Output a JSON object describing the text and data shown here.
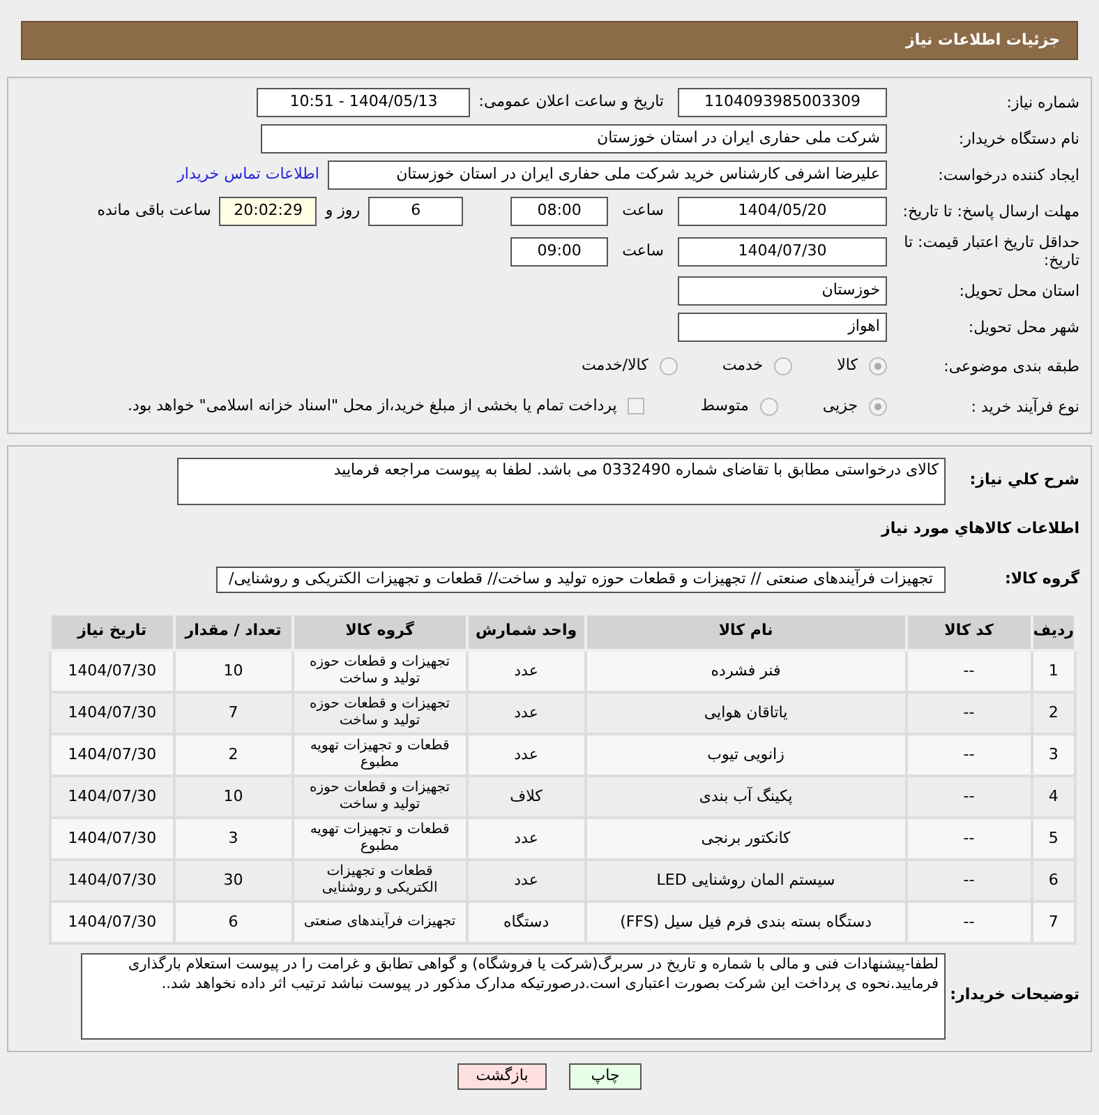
{
  "header": {
    "title": "جزئیات اطلاعات نیاز"
  },
  "need_number": {
    "label": "شماره نیاز:",
    "value": "1104093985003309"
  },
  "announce": {
    "label": "تاریخ و ساعت اعلان عمومی:",
    "value": "1404/05/13 - 10:51"
  },
  "buyer_org": {
    "label": "نام دستگاه خریدار:",
    "value": "شرکت ملی حفاری ایران در استان خوزستان"
  },
  "creator": {
    "label": "ایجاد کننده درخواست:",
    "value": "علیرضا اشرفی کارشناس خرید شرکت ملی حفاری ایران در استان خوزستان",
    "link": "اطلاعات تماس خریدار"
  },
  "deadline": {
    "label": "مهلت ارسال پاسخ: تا تاریخ:",
    "date": "1404/05/20",
    "time_label": "ساعت",
    "time": "08:00",
    "days": "6",
    "days_label": "روز و",
    "remaining": "20:02:29",
    "remaining_label": "ساعت باقی مانده"
  },
  "validity": {
    "label": "حداقل تاریخ اعتبار قیمت: تا تاریخ:",
    "date": "1404/07/30",
    "time_label": "ساعت",
    "time": "09:00"
  },
  "province": {
    "label": "استان محل تحویل:",
    "value": "خوزستان"
  },
  "city": {
    "label": "شهر محل تحویل:",
    "value": "اهواز"
  },
  "category": {
    "label": "طبقه بندی موضوعی:",
    "options": [
      {
        "label": "کالا",
        "selected": true
      },
      {
        "label": "خدمت",
        "selected": false
      },
      {
        "label": "کالا/خدمت",
        "selected": false
      }
    ]
  },
  "process": {
    "label": "نوع فرآیند خرید :",
    "options": [
      {
        "label": "جزیی",
        "selected": true
      },
      {
        "label": "متوسط",
        "selected": false
      }
    ],
    "payment": {
      "label": "پرداخت تمام یا بخشی از مبلغ خرید،از محل \"اسناد خزانه اسلامی\" خواهد بود.",
      "checked": false
    }
  },
  "description": {
    "label": "شرح کلي نياز:",
    "value": "کالای درخواستی مطابق با تقاضای شماره 0332490 می باشد. لطفا به پیوست مراجعه فرمایید"
  },
  "goods_title": "اطلاعات کالاهاي مورد نياز",
  "group": {
    "label": "گروه کالا:",
    "value": "تجهیزات فرآیندهای صنعتی // تجهیزات و قطعات حوزه تولید و ساخت// قطعات و تجهیزات الکتریکی و روشنایی/"
  },
  "table": {
    "columns": [
      "ردیف",
      "کد کالا",
      "نام کالا",
      "واحد شمارش",
      "گروه کالا",
      "تعداد / مقدار",
      "تاریخ نیاز"
    ],
    "rows": [
      [
        "1",
        "--",
        "فنر فشرده",
        "عدد",
        "تجهیزات و قطعات حوزه تولید و ساخت",
        "10",
        "1404/07/30"
      ],
      [
        "2",
        "--",
        "یاتاقان هوایی",
        "عدد",
        "تجهیزات و قطعات حوزه تولید و ساخت",
        "7",
        "1404/07/30"
      ],
      [
        "3",
        "--",
        "زانویی تیوب",
        "عدد",
        "قطعات و تجهیزات تهویه مطبوع",
        "2",
        "1404/07/30"
      ],
      [
        "4",
        "--",
        "پکینگ آب بندی",
        "کلاف",
        "تجهیزات و قطعات حوزه تولید و ساخت",
        "10",
        "1404/07/30"
      ],
      [
        "5",
        "--",
        "کانکتور برنجی",
        "عدد",
        "قطعات و تجهیزات تهویه مطبوع",
        "3",
        "1404/07/30"
      ],
      [
        "6",
        "--",
        "سیستم المان روشنایی LED",
        "عدد",
        "قطعات و تجهیزات الکتریکی و روشنایی",
        "30",
        "1404/07/30"
      ],
      [
        "7",
        "--",
        "دستگاه بسته بندی فرم فیل سیل (FFS)",
        "دستگاه",
        "تجهیزات فرآیندهای صنعتی",
        "6",
        "1404/07/30"
      ]
    ]
  },
  "buyer_notes": {
    "label": "توضیحات خریدار:",
    "value": "لطفا-پیشنهادات فنی و مالی با شماره و تاریخ در سربرگ(شرکت یا فروشگاه) و گواهی تطابق و غرامت را در پیوست استعلام بارگذاری فرمایید.نحوه ی پرداخت این شرکت بصورت اعتباری است.درصورتیکه مدارک مذکور در پیوست نباشد ترتیب اثر داده نخواهد شد.."
  },
  "buttons": [
    {
      "label": "چاپ",
      "kind": "print"
    },
    {
      "label": "بازگشت",
      "kind": "back"
    }
  ]
}
